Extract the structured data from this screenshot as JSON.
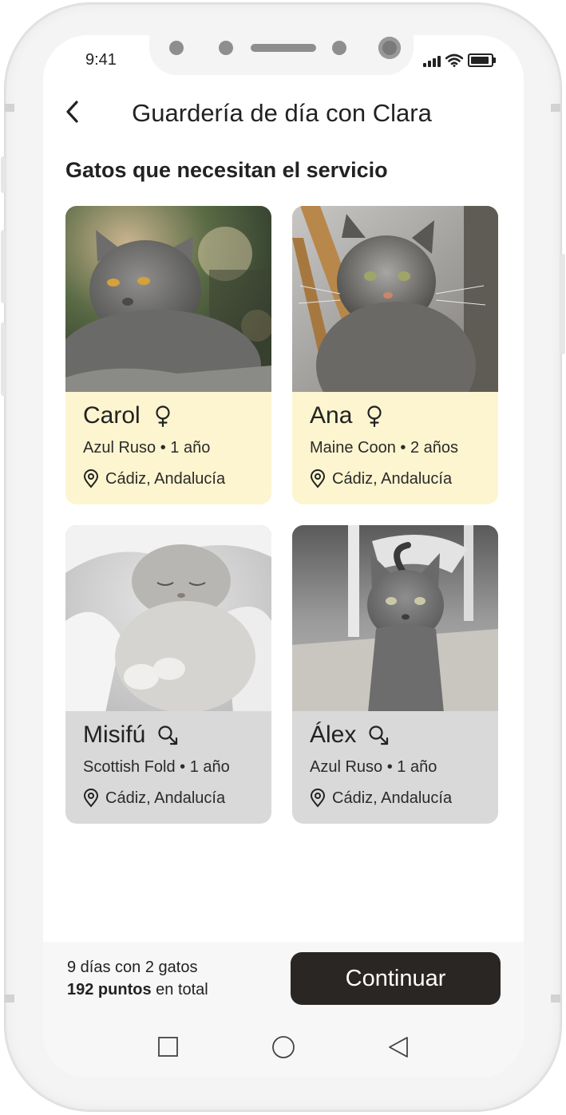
{
  "status": {
    "time": "9:41"
  },
  "header": {
    "title": "Guardería de día con Clara"
  },
  "section_title": "Gatos que necesitan el servicio",
  "cats": [
    {
      "name": "Carol",
      "gender": "female",
      "breed_age": "Azul Ruso • 1 año",
      "location": "Cádiz, Andalucía",
      "card_color": "#fdf5cf",
      "selected": true
    },
    {
      "name": "Ana",
      "gender": "female",
      "breed_age": "Maine Coon • 2 años",
      "location": "Cádiz, Andalucía",
      "card_color": "#fdf5cf",
      "selected": true
    },
    {
      "name": "Misifú",
      "gender": "male",
      "breed_age": "Scottish Fold • 1 año",
      "location": "Cádiz, Andalucía",
      "card_color": "#d9d9d9",
      "selected": false
    },
    {
      "name": "Álex",
      "gender": "male",
      "breed_age": "Azul Ruso • 1 año",
      "location": "Cádiz, Andalucía",
      "card_color": "#d9d9d9",
      "selected": false
    }
  ],
  "footer": {
    "summary_line1": "9 días con 2 gatos",
    "points_bold": "192 puntos",
    "points_rest": " en total",
    "continue_label": "Continuar"
  },
  "colors": {
    "accent": "#2a2624",
    "selected_card": "#fdf5cf",
    "unselected_card": "#d9d9d9"
  },
  "icons": [
    "back-chevron-icon",
    "female-icon",
    "male-icon",
    "location-pin-icon",
    "signal-icon",
    "wifi-icon",
    "battery-icon",
    "square-nav-icon",
    "circle-nav-icon",
    "triangle-back-icon"
  ]
}
